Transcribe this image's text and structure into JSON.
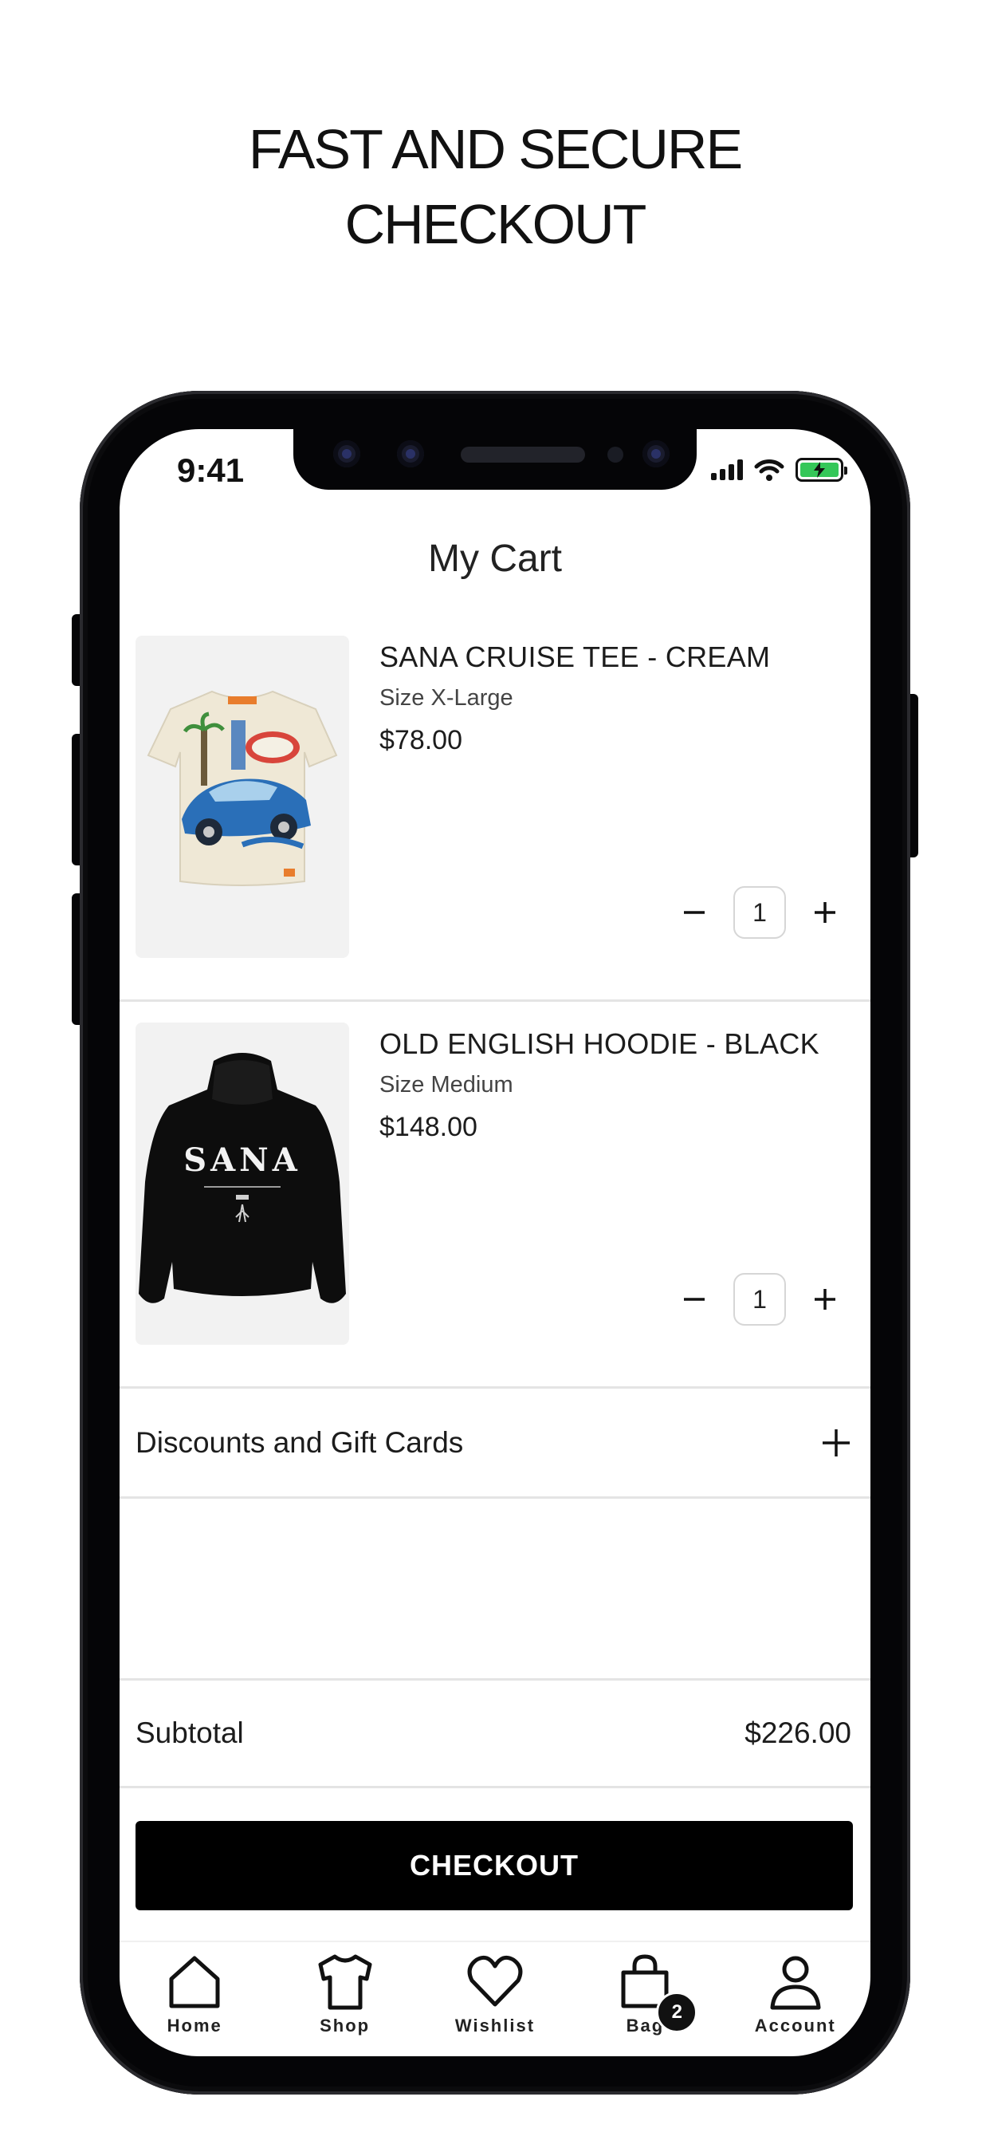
{
  "headline": {
    "line1": "FAST AND SECURE",
    "line2": "CHECKOUT"
  },
  "status_bar": {
    "time": "9:41"
  },
  "cart": {
    "title": "My Cart",
    "items": [
      {
        "name": "SANA CRUISE TEE - CREAM",
        "size": "Size X-Large",
        "price": "$78.00",
        "quantity": "1"
      },
      {
        "name": "OLD ENGLISH HOODIE - BLACK",
        "size": "Size Medium",
        "price": "$148.00",
        "quantity": "1"
      }
    ],
    "hoodie_print": "SANA",
    "discounts_label": "Discounts and Gift Cards",
    "subtotal_label": "Subtotal",
    "subtotal_value": "$226.00",
    "checkout_label": "CHECKOUT"
  },
  "tabbar": {
    "tabs": [
      {
        "label": "Home",
        "icon": "home-icon"
      },
      {
        "label": "Shop",
        "icon": "shirt-icon"
      },
      {
        "label": "Wishlist",
        "icon": "heart-icon"
      },
      {
        "label": "Bag",
        "icon": "bag-icon"
      },
      {
        "label": "Account",
        "icon": "person-icon"
      }
    ],
    "bag_count": "2"
  },
  "colors": {
    "accent": "#000000",
    "battery": "#35c759",
    "thumb_bg": "#f2f2f2"
  }
}
